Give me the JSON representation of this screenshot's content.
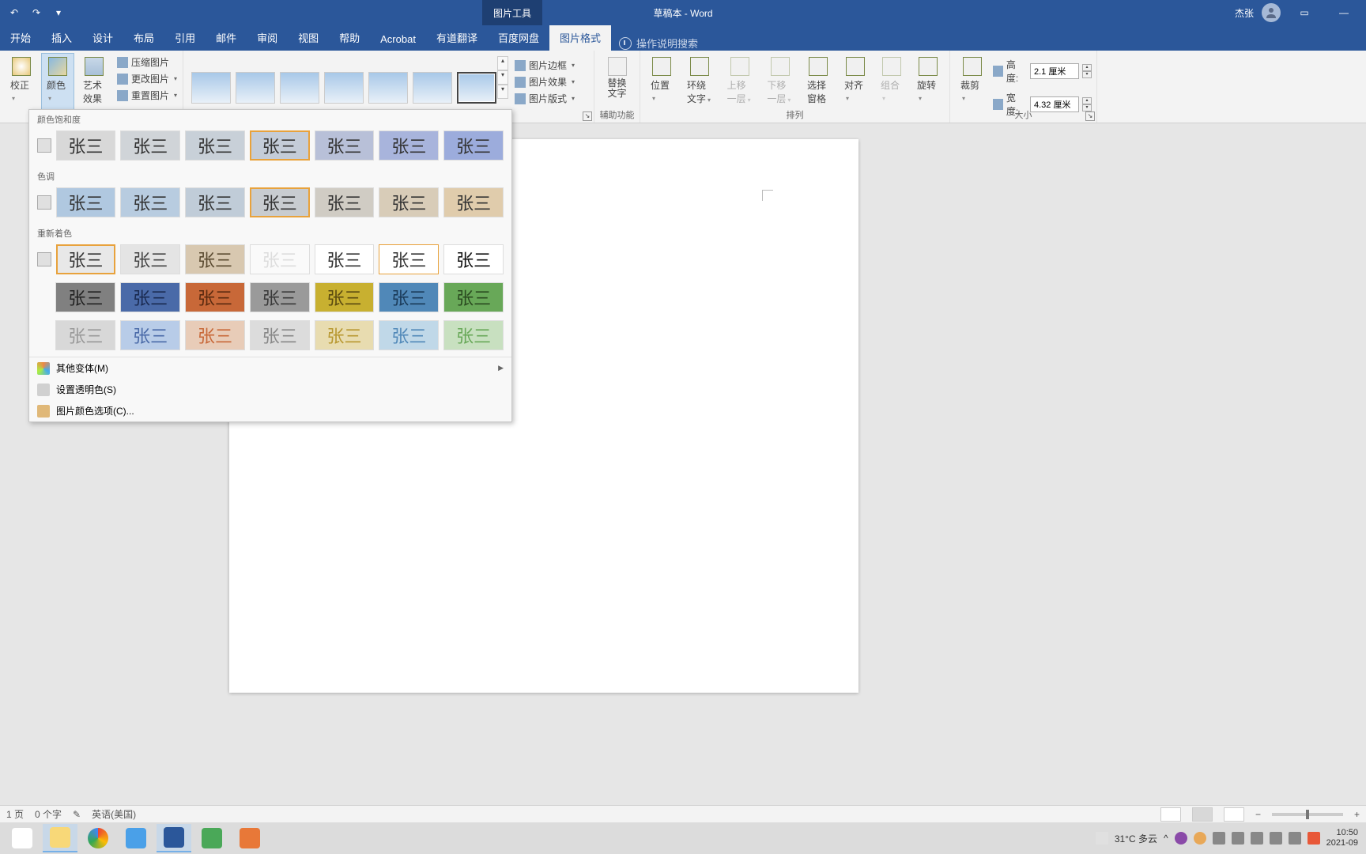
{
  "titlebar": {
    "doc_title": "草稿本 - Word",
    "tool_tab": "图片工具",
    "user_name": "杰张",
    "minimize": "—"
  },
  "tabs": [
    "开始",
    "插入",
    "设计",
    "布局",
    "引用",
    "邮件",
    "审阅",
    "视图",
    "帮助",
    "Acrobat",
    "有道翻译",
    "百度网盘",
    "图片格式"
  ],
  "tell_me": "操作说明搜索",
  "ribbon": {
    "corrections": "校正",
    "color": "颜色",
    "artistic": "艺术效果",
    "compress": "压缩图片",
    "change": "更改图片",
    "reset": "重置图片",
    "border": "图片边框",
    "effects": "图片效果",
    "layout": "图片版式",
    "alt_text": "替换文字",
    "accessibility_grp": "辅助功能",
    "position": "位置",
    "wrap": "环绕文字",
    "forward": "上移一层",
    "backward": "下移一层",
    "selection_pane": "选择窗格",
    "align": "对齐",
    "group": "组合",
    "rotate": "旋转",
    "arrange_grp": "排列",
    "crop": "裁剪",
    "height_lbl": "高度:",
    "height_val": "2.1 厘米",
    "width_lbl": "宽度:",
    "width_val": "4.32 厘米",
    "size_grp": "大小"
  },
  "color_panel": {
    "section1": "颜色饱和度",
    "section2": "色调",
    "section3": "重新着色",
    "more_variants": "其他变体(M)",
    "set_transparent": "设置透明色(S)",
    "color_options": "图片颜色选项(C)...",
    "sample_text": "张三",
    "saturation_bgs": [
      "#d8d8d8",
      "#d0d4d8",
      "#c8d0d8",
      "#c4ccd8",
      "#b8c0d8",
      "#a8b4dc",
      "#9cacdc"
    ],
    "tone_bgs": [
      "#b0c8e0",
      "#b8cce0",
      "#c0ccd8",
      "#c8ccd0",
      "#d0ccc4",
      "#d8ccb8",
      "#e0ccac"
    ],
    "recolor": [
      [
        {
          "bg": "#e8e8e8",
          "c": "#333"
        },
        {
          "bg": "#e4e4e4",
          "c": "#444"
        },
        {
          "bg": "#d8c8b0",
          "c": "#5a4a30"
        },
        {
          "bg": "#fafafa",
          "c": "#ddd"
        },
        {
          "bg": "#ffffff",
          "c": "#333"
        },
        {
          "bg": "#ffffff",
          "c": "#333"
        },
        {
          "bg": "#ffffff",
          "c": "#111"
        }
      ],
      [
        {
          "bg": "#808080",
          "c": "#222"
        },
        {
          "bg": "#4a6aa8",
          "c": "#1a2a50"
        },
        {
          "bg": "#c86838",
          "c": "#5a2a10"
        },
        {
          "bg": "#9a9a9a",
          "c": "#3a3a3a"
        },
        {
          "bg": "#c8b030",
          "c": "#5a4a10"
        },
        {
          "bg": "#5088b8",
          "c": "#1a3a58"
        },
        {
          "bg": "#68a858",
          "c": "#2a4a20"
        }
      ],
      [
        {
          "bg": "#d8d8d8",
          "c": "#999"
        },
        {
          "bg": "#b8cce8",
          "c": "#4a6aa8"
        },
        {
          "bg": "#e8ccb8",
          "c": "#c86838"
        },
        {
          "bg": "#dcdcdc",
          "c": "#888"
        },
        {
          "bg": "#e8dcb0",
          "c": "#b89830"
        },
        {
          "bg": "#c0d8e8",
          "c": "#5088b8"
        },
        {
          "bg": "#c8e0c0",
          "c": "#68a858"
        }
      ]
    ]
  },
  "statusbar": {
    "page": "1 页",
    "words": "0 个字",
    "lang": "英语(美国)"
  },
  "taskbar": {
    "weather": "31°C 多云",
    "time": "10:50",
    "date": "2021-09"
  }
}
